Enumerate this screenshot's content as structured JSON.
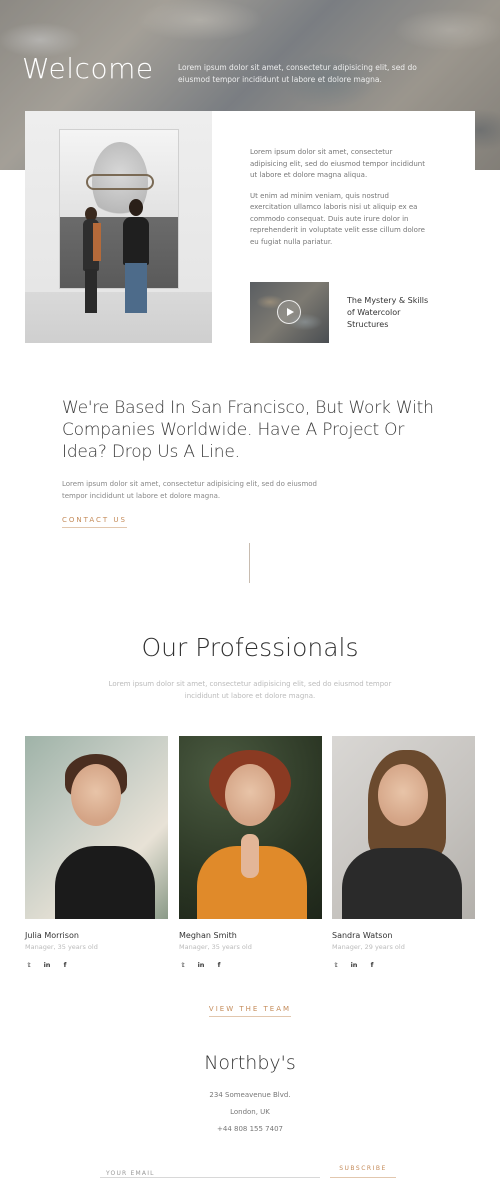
{
  "hero": {
    "title": "Welcome",
    "text": "Lorem ipsum dolor sit amet, consectetur adipisicing elit, sed do eiusmod tempor incididunt ut labore et dolore magna."
  },
  "feature": {
    "paragraph1": "Lorem ipsum dolor sit amet, consectetur adipisicing elit, sed do eiusmod tempor incididunt ut labore et dolore magna aliqua.",
    "paragraph2": "Ut enim ad minim veniam, quis nostrud exercitation ullamco laboris nisi ut aliquip ex ea commodo consequat. Duis aute irure dolor in reprehenderit in voluptate velit esse cillum dolore eu fugiat nulla pariatur.",
    "video_title": "The Mystery & Skills of Watercolor Structures"
  },
  "intro": {
    "heading": "We're Based In San Francisco, But Work With Companies Worldwide. Have A Project Or Idea? Drop Us A Line.",
    "text": "Lorem ipsum dolor sit amet, consectetur adipisicing elit, sed do eiusmod tempor incididunt ut labore et dolore magna.",
    "contact_label": "CONTACT US"
  },
  "professionals": {
    "title": "Our Professionals",
    "subtitle": "Lorem ipsum dolor sit amet, consectetur adipisicing elit, sed do eiusmod tempor incididunt ut labore et dolore magna.",
    "members": [
      {
        "name": "Julia Morrison",
        "role": "Manager, 35 years old"
      },
      {
        "name": "Meghan Smith",
        "role": "Manager, 35 years old"
      },
      {
        "name": "Sandra Watson",
        "role": "Manager, 29 years old"
      }
    ],
    "social": {
      "twitter": "𝕥",
      "linkedin": "in",
      "facebook": "f"
    },
    "view_team_label": "VIEW THE TEAM"
  },
  "footer": {
    "brand": "Northby's",
    "address_line1": "234 Someavenue Blvd.",
    "address_line2": "London, UK",
    "phone": "+44 808 155 7407",
    "email_placeholder": "YOUR EMAIL",
    "subscribe_label": "SUBSCRIBE"
  },
  "colors": {
    "accent": "#c48b5a",
    "text": "#333333",
    "muted": "#bbbbbb"
  }
}
